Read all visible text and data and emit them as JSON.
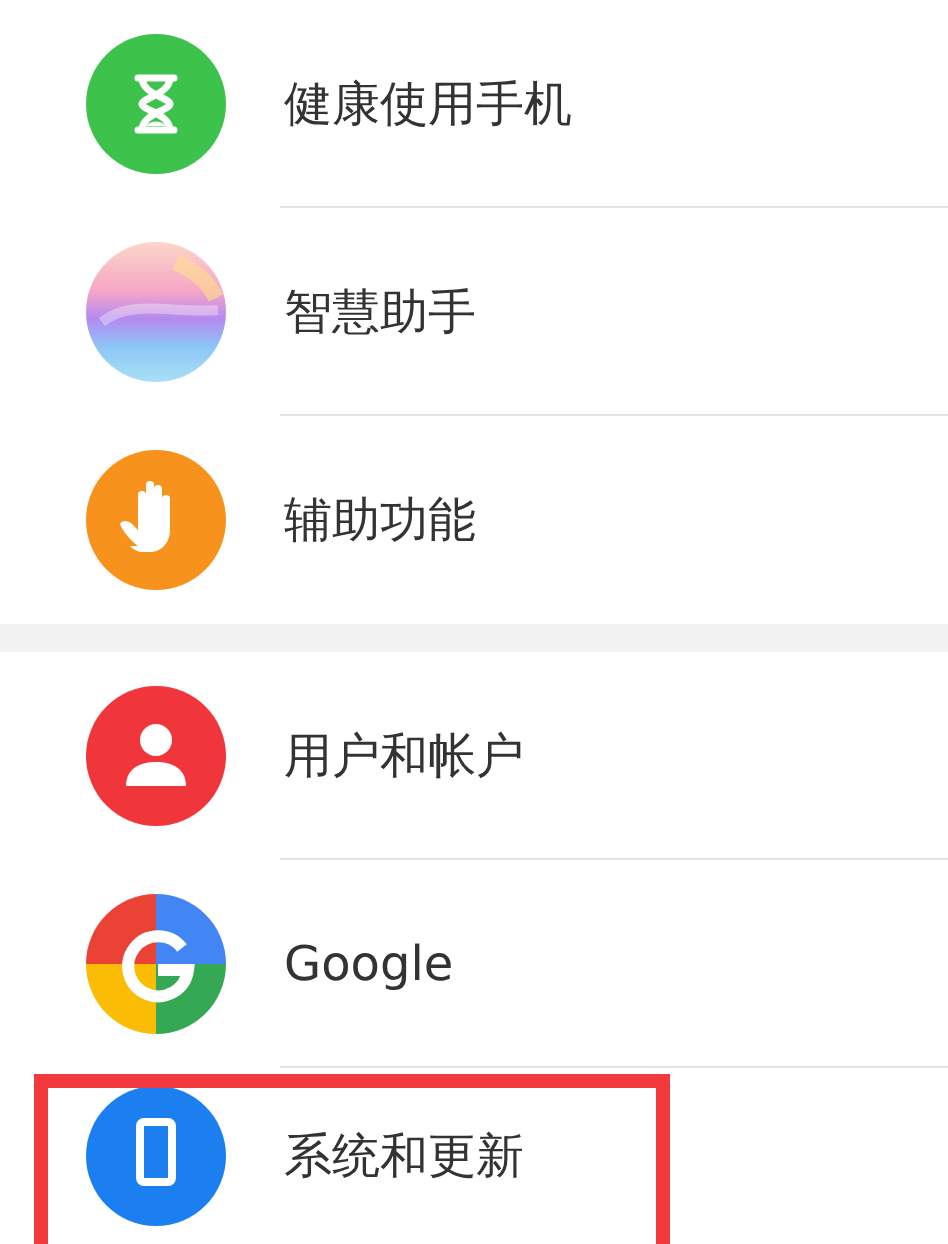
{
  "sections": [
    {
      "items": [
        {
          "label": "健康使用手机",
          "kind": "hourglass",
          "highlighted": false
        },
        {
          "label": "智慧助手",
          "kind": "assistant",
          "highlighted": false
        },
        {
          "label": "辅助功能",
          "kind": "hand",
          "highlighted": false
        }
      ]
    },
    {
      "items": [
        {
          "label": "用户和帐户",
          "kind": "person",
          "highlighted": false
        },
        {
          "label": "Google",
          "kind": "google",
          "highlighted": false
        },
        {
          "label": "系统和更新",
          "kind": "phone",
          "highlighted": true
        }
      ]
    }
  ]
}
